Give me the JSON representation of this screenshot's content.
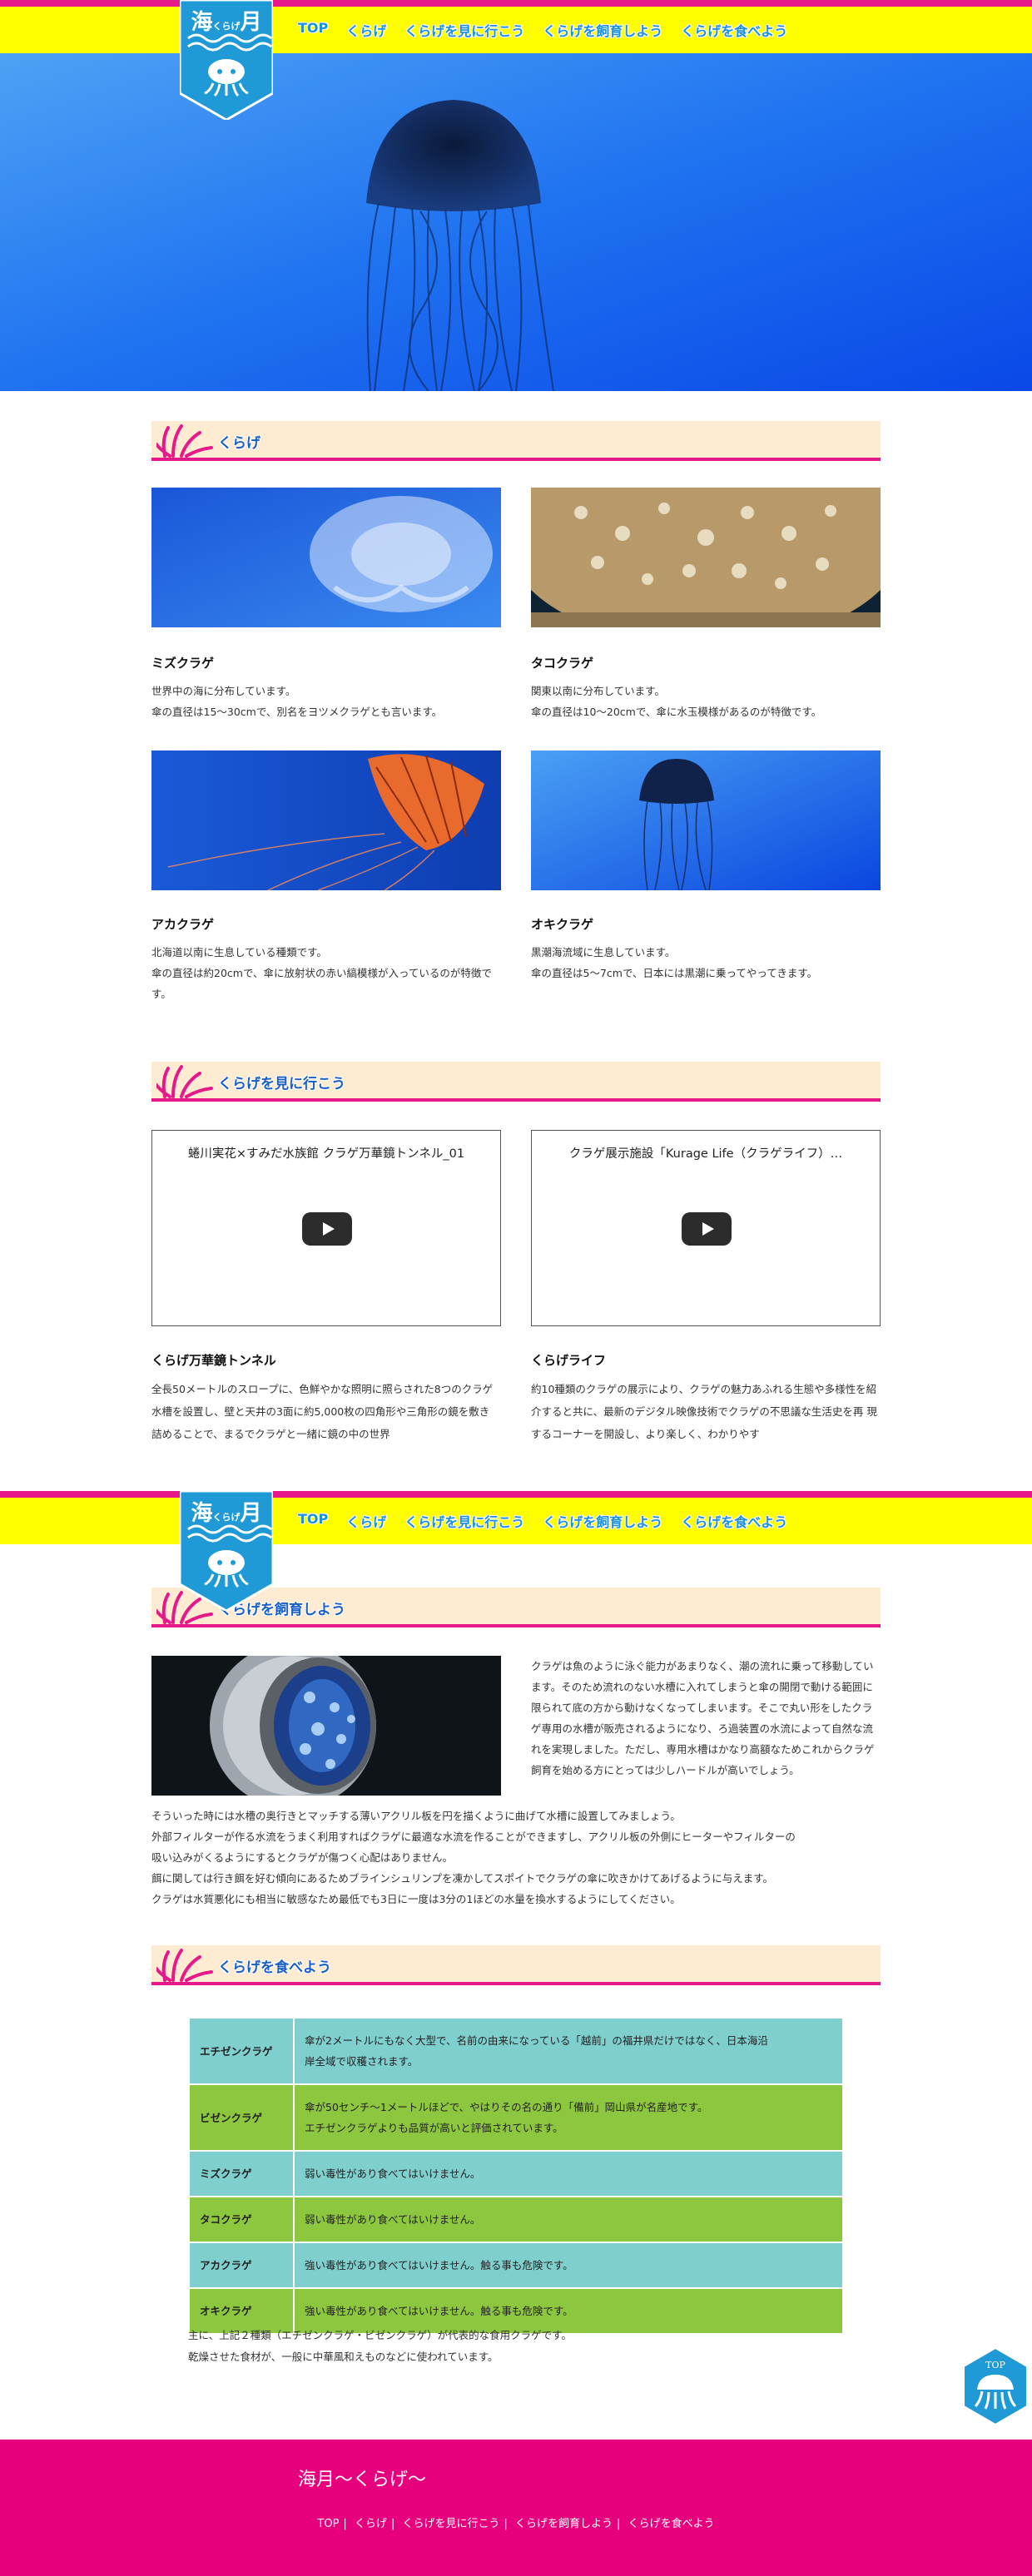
{
  "logo": {
    "main": "海",
    "small": "くらげ",
    "moon": "月"
  },
  "nav": [
    "TOP",
    "くらげ",
    "くらげを見に行こう",
    "くらげを飼育しよう",
    "くらげを食べよう"
  ],
  "sections": {
    "kurage": "くらげ",
    "visit": "くらげを見に行こう",
    "breed": "くらげを飼育しよう",
    "eat": "くらげを食べよう"
  },
  "cards": [
    {
      "title": "ミズクラゲ",
      "lines": [
        "世界中の海に分布しています。",
        "傘の直径は15～30cmで、別名をヨツメクラゲとも言います。"
      ]
    },
    {
      "title": "タコクラゲ",
      "lines": [
        "関東以南に分布しています。",
        "傘の直径は10～20cmで、傘に水玉模様があるのが特徴です。"
      ]
    },
    {
      "title": "アカクラゲ",
      "lines": [
        "北海道以南に生息している種類です。",
        "傘の直径は約20cmで、傘に放射状の赤い縞模様が入っているのが特徴です。"
      ]
    },
    {
      "title": "オキクラゲ",
      "lines": [
        "黒潮海流域に生息しています。",
        "傘の直径は5～7cmで、日本には黒潮に乗ってやってきます。"
      ]
    }
  ],
  "videos": [
    {
      "embed_title": "蜷川実花×すみだ水族館 クラゲ万華鏡トンネル_01",
      "title": "くらげ万華鏡トンネル",
      "text": "全長50メートルのスロープに、色鮮やかな照明に照らされた8つのクラゲ水槽を設置し、壁と天井の3面に約5,000枚の四角形や三角形の鏡を敷き 詰めることで、まるでクラゲと一緒に鏡の中の世界"
    },
    {
      "embed_title": "クラゲ展示施設「Kurage Life（クラゲライフ）…",
      "title": "くらげライフ",
      "text": "約10種類のクラゲの展示により、クラゲの魅力あふれる生態や多様性を紹介すると共に、最新のデジタル映像技術でクラゲの不思議な生活史を再 現するコーナーを開設し、より楽しく、わかりやす"
    }
  ],
  "breed": {
    "side": "クラゲは魚のように泳ぐ能力があまりなく、潮の流れに乗って移動しています。そのため流れのない水槽に入れてしまうと傘の開閉で動ける範囲に 限られて底の方から動けなくなってしまいます。そこで丸い形をしたクラゲ専用の水槽が販売されるようになり、ろ過装置の水流によって自然な流 れを実現しました。ただし、専用水槽はかなり高額なためこれからクラゲ飼育を始める方にとっては少しハードルが高いでしょう。",
    "lines": [
      "そういった時には水槽の奥行きとマッチする薄いアクリル板を円を描くように曲げて水槽に設置してみましょう。",
      "外部フィルターが作る水流をうまく利用すればクラゲに最適な水流を作ることができますし、アクリル板の外側にヒーターやフィルターの",
      "吸い込みがくるようにするとクラゲが傷つく心配はありません。",
      "餌に関しては行き餌を好む傾向にあるためブラインシュリンプを凍かしてスポイトでクラゲの傘に吹きかけてあげるように与えます。",
      "クラゲは水質悪化にも相当に敏感なため最低でも3日に一度は3分の1ほどの水量を換水するようにしてください。"
    ]
  },
  "eat_table": [
    {
      "name": "エチゼンクラゲ",
      "lines": [
        "傘が2メートルにもなく大型で、名前の由来になっている「越前」の福井県だけではなく、日本海沿",
        "岸全域で収穫されます。"
      ]
    },
    {
      "name": "ビゼンクラゲ",
      "lines": [
        "傘が50センチ～1メートルほどで、やはりその名の通り「備前」岡山県が名産地です。",
        "エチゼンクラゲよりも品質が高いと評価されています。"
      ]
    },
    {
      "name": "ミズクラゲ",
      "lines": [
        "弱い毒性があり食べてはいけません。"
      ]
    },
    {
      "name": "タコクラゲ",
      "lines": [
        "弱い毒性があり食べてはいけません。"
      ]
    },
    {
      "name": "アカクラゲ",
      "lines": [
        "強い毒性があり食べてはいけません。触る事も危険です。"
      ]
    },
    {
      "name": "オキクラゲ",
      "lines": [
        "強い毒性があり食べてはいけません。触る事も危険です。"
      ]
    }
  ],
  "eat_notes": [
    "主に、上記２種類（エチゼンクラゲ・ビゼンクラゲ）が代表的な食用クラゲです。",
    "乾燥させた食材が、一般に中華風和えものなどに使われています。"
  ],
  "top_button": "TOP",
  "footer": {
    "title": "海月～くらげ～",
    "links": [
      "TOP",
      "くらげ",
      "くらげを見に行こう",
      "くらげを飼育しよう",
      "くらげを食べよう"
    ],
    "separator": "|"
  },
  "colors": {
    "accent": "#e6198a",
    "header": "#ffff00",
    "nav_text": "#1a8fe0",
    "heading_bg": "#fdebd2",
    "table_teal": "#7ecfcd",
    "table_green": "#8dc63f",
    "footer": "#e6007e"
  }
}
